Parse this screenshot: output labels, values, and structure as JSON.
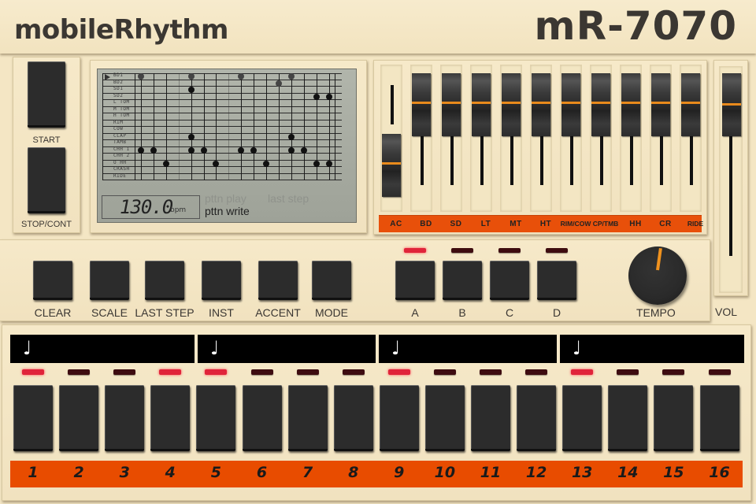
{
  "header": {
    "app_name": "mobileRhythm",
    "model_name": "mR-7070"
  },
  "transport": {
    "start_label": "START",
    "stop_label": "STOP/CONT"
  },
  "lcd": {
    "instruments": [
      "BD1",
      "BD2",
      "SD1",
      "SD2",
      "L TOM",
      "M TOM",
      "H TOM",
      "RIM",
      "COW",
      "CLAP",
      "TAMB",
      "CHH 1",
      "CHH 2",
      "O HH",
      "CRASH",
      "RIDE"
    ],
    "selected_instrument": "BD1",
    "steps": 16,
    "pattern": {
      "BD1": [
        1,
        5,
        9,
        13
      ],
      "BD2": [
        12
      ],
      "SD1": [
        5
      ],
      "SD2": [
        15,
        16
      ],
      "L TOM": [],
      "M TOM": [],
      "H TOM": [],
      "RIM": [],
      "COW": [],
      "CLAP": [
        5,
        13
      ],
      "TAMB": [],
      "CHH 1": [
        1,
        2,
        5,
        6,
        9,
        10,
        13,
        14
      ],
      "CHH 2": [],
      "O HH": [
        3,
        7,
        11,
        15,
        16
      ],
      "CRASH": [],
      "RIDE": []
    },
    "bpm_value": "130.0",
    "bpm_unit": "bpm",
    "mode_pttn_play": "pttn play",
    "mode_last_step": "last step",
    "mode_pttn_write": "pttn write",
    "active_mode": "pttn write"
  },
  "mixer": {
    "channels": [
      {
        "label": "AC",
        "level": 0.45
      },
      {
        "label": "BD",
        "level": 1.0
      },
      {
        "label": "SD",
        "level": 1.0
      },
      {
        "label": "LT",
        "level": 1.0
      },
      {
        "label": "MT",
        "level": 1.0
      },
      {
        "label": "HT",
        "level": 1.0
      },
      {
        "label": "Rim/Cow",
        "level": 1.0
      },
      {
        "label": "Cp/Tmb",
        "level": 1.0
      },
      {
        "label": "HH",
        "level": 1.0
      },
      {
        "label": "CR",
        "level": 1.0
      },
      {
        "label": "Ride",
        "level": 1.0
      }
    ]
  },
  "volume": {
    "label": "VOL",
    "level": 1.0
  },
  "functions": {
    "buttons": [
      "CLEAR",
      "SCALE",
      "LAST STEP",
      "INST",
      "ACCENT",
      "MODE"
    ]
  },
  "patterns": {
    "buttons": [
      {
        "label": "A",
        "active": true
      },
      {
        "label": "B",
        "active": false
      },
      {
        "label": "C",
        "active": false
      },
      {
        "label": "D",
        "active": false
      }
    ]
  },
  "tempo": {
    "label": "TEMPO"
  },
  "steps": {
    "beat_icon": "♩",
    "numbers": [
      "1",
      "2",
      "3",
      "4",
      "5",
      "6",
      "7",
      "8",
      "9",
      "10",
      "11",
      "12",
      "13",
      "14",
      "15",
      "16"
    ],
    "leds_on": [
      1,
      4,
      5,
      9,
      13
    ]
  },
  "colors": {
    "accent_orange": "#e84c00",
    "led_on": "#e0243a",
    "led_off": "#3e0c10",
    "panel": "#f4e6c4",
    "lcd": "#a8aca2"
  }
}
